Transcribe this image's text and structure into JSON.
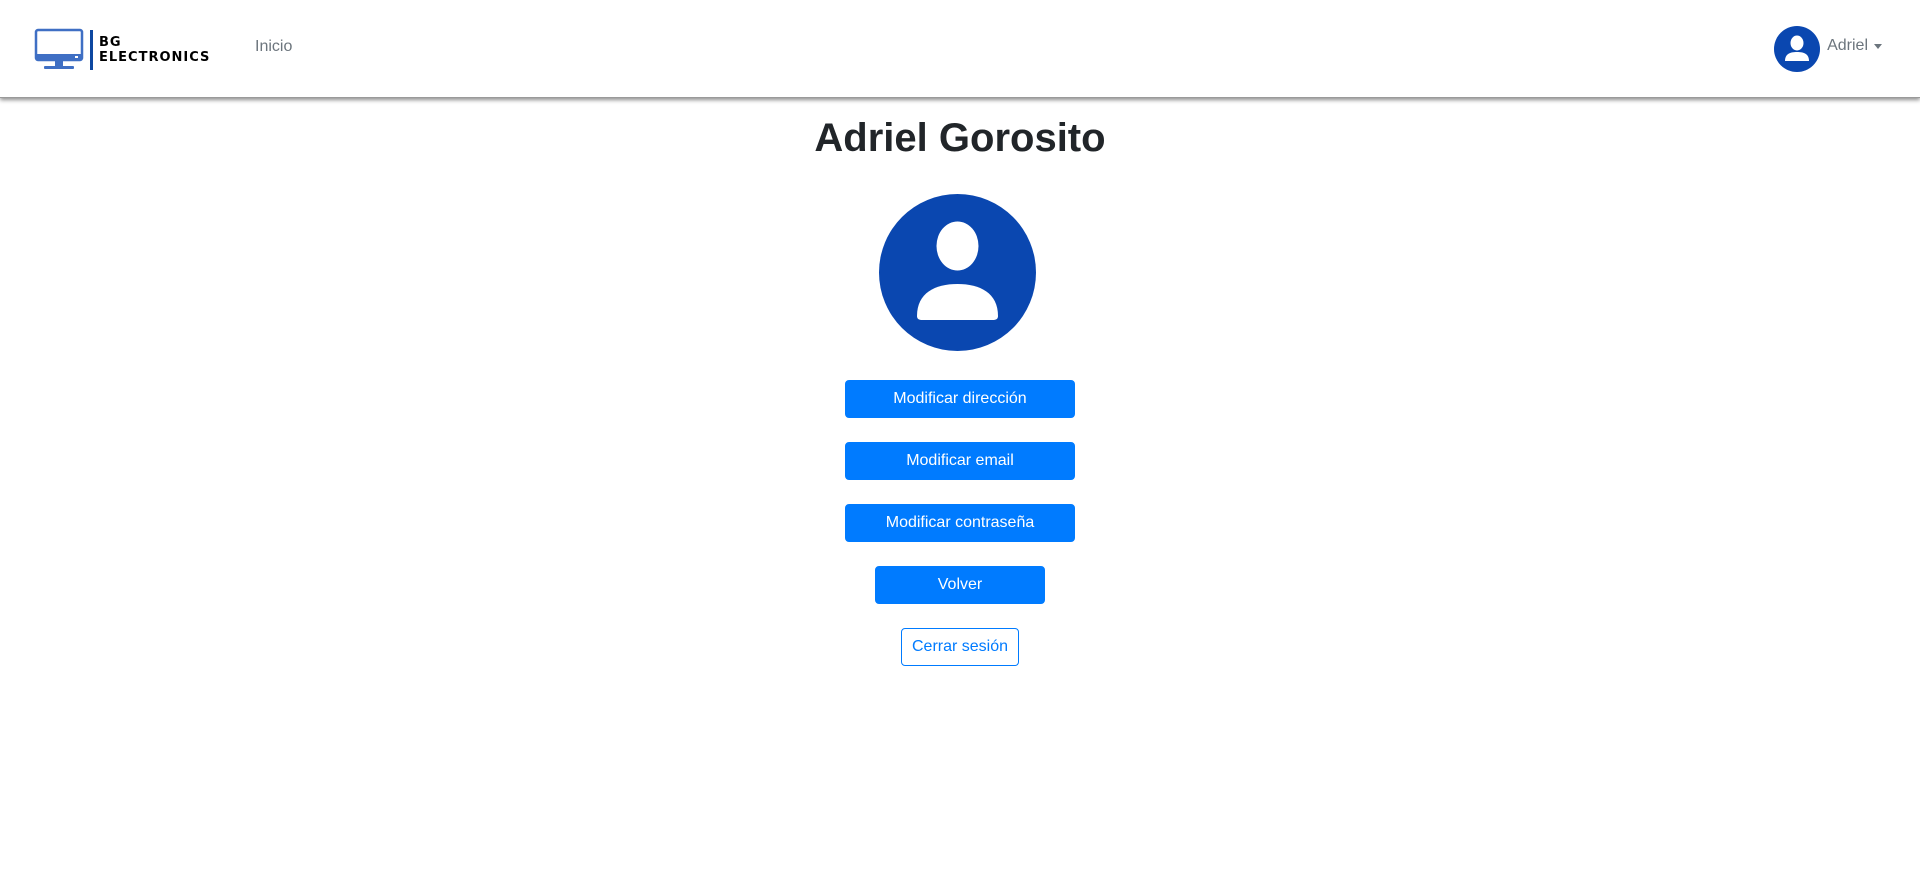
{
  "navbar": {
    "brand": {
      "line1": "BG",
      "line2": "ELECTRONICS"
    },
    "nav_link": "Inicio",
    "user": {
      "name": "Adriel",
      "avatar_icon": "user-icon"
    }
  },
  "profile": {
    "full_name": "Adriel Gorosito",
    "avatar_icon": "user-icon",
    "buttons": {
      "modify_address": "Modificar dirección",
      "modify_email": "Modificar email",
      "modify_password": "Modificar contraseña",
      "back": "Volver",
      "logout": "Cerrar sesión"
    }
  },
  "colors": {
    "primary": "#007bff",
    "avatar_bg": "#0a47b0",
    "brand_blue": "#0d47a1"
  }
}
